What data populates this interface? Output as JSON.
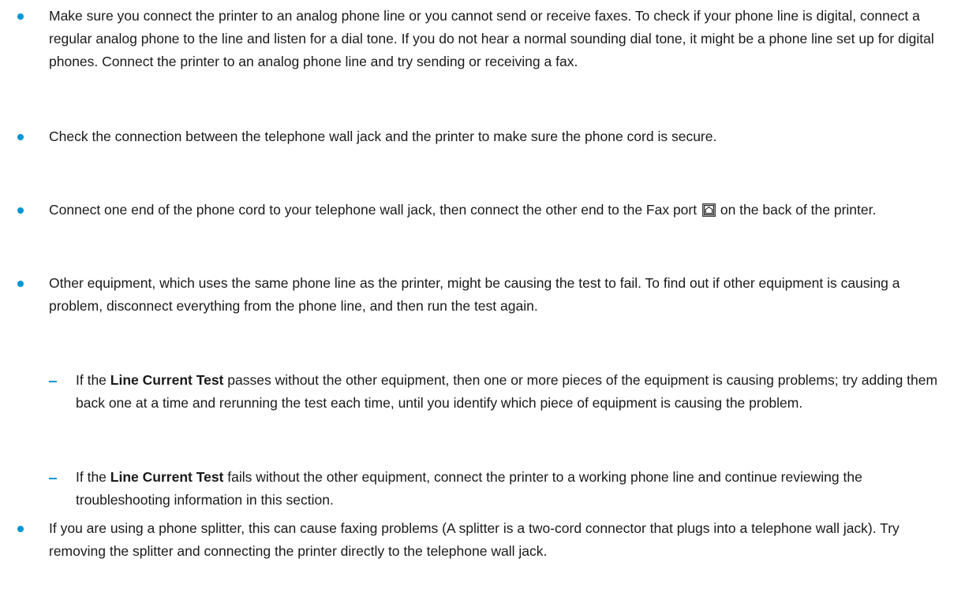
{
  "bullets": [
    {
      "text": "Make sure you connect the printer to an analog phone line or you cannot send or receive faxes. To check if your phone line is digital, connect a regular analog phone to the line and listen for a dial tone. If you do not hear a normal sounding dial tone, it might be a phone line set up for digital phones. Connect the printer to an analog phone line and try sending or receiving a fax."
    },
    {
      "text": "Check the connection between the telephone wall jack and the printer to make sure the phone cord is secure."
    },
    {
      "text_before_icon": "Connect one end of the phone cord to your telephone wall jack, then connect the other end to the Fax port",
      "icon": "fax-port-icon",
      "text_after_icon": "on the back of the printer."
    },
    {
      "text": "Other equipment, which uses the same phone line as the printer, might be causing the test to fail. To find out if other equipment is causing a problem, disconnect everything from the phone line, and then run the test again.",
      "subitems": [
        {
          "prefix": "If the",
          "bold": "Line Current Test",
          "suffix": "passes without the other equipment, then one or more pieces of the equipment is causing problems; try adding them back one at a time and rerunning the test each time, until you identify which piece of equipment is causing the problem."
        },
        {
          "prefix": "If the",
          "bold": "Line Current Test",
          "suffix": "fails without the other equipment, connect the printer to a working phone line and continue reviewing the troubleshooting information in this section."
        }
      ]
    },
    {
      "text": "If you are using a phone splitter, this can cause faxing problems (A splitter is a two-cord connector that plugs into a telephone wall jack). Try removing the splitter and connecting the printer directly to the telephone wall jack."
    }
  ],
  "colors": {
    "bullet": "#0096d6",
    "text": "#1a1a1a",
    "background": "#ffffff"
  }
}
